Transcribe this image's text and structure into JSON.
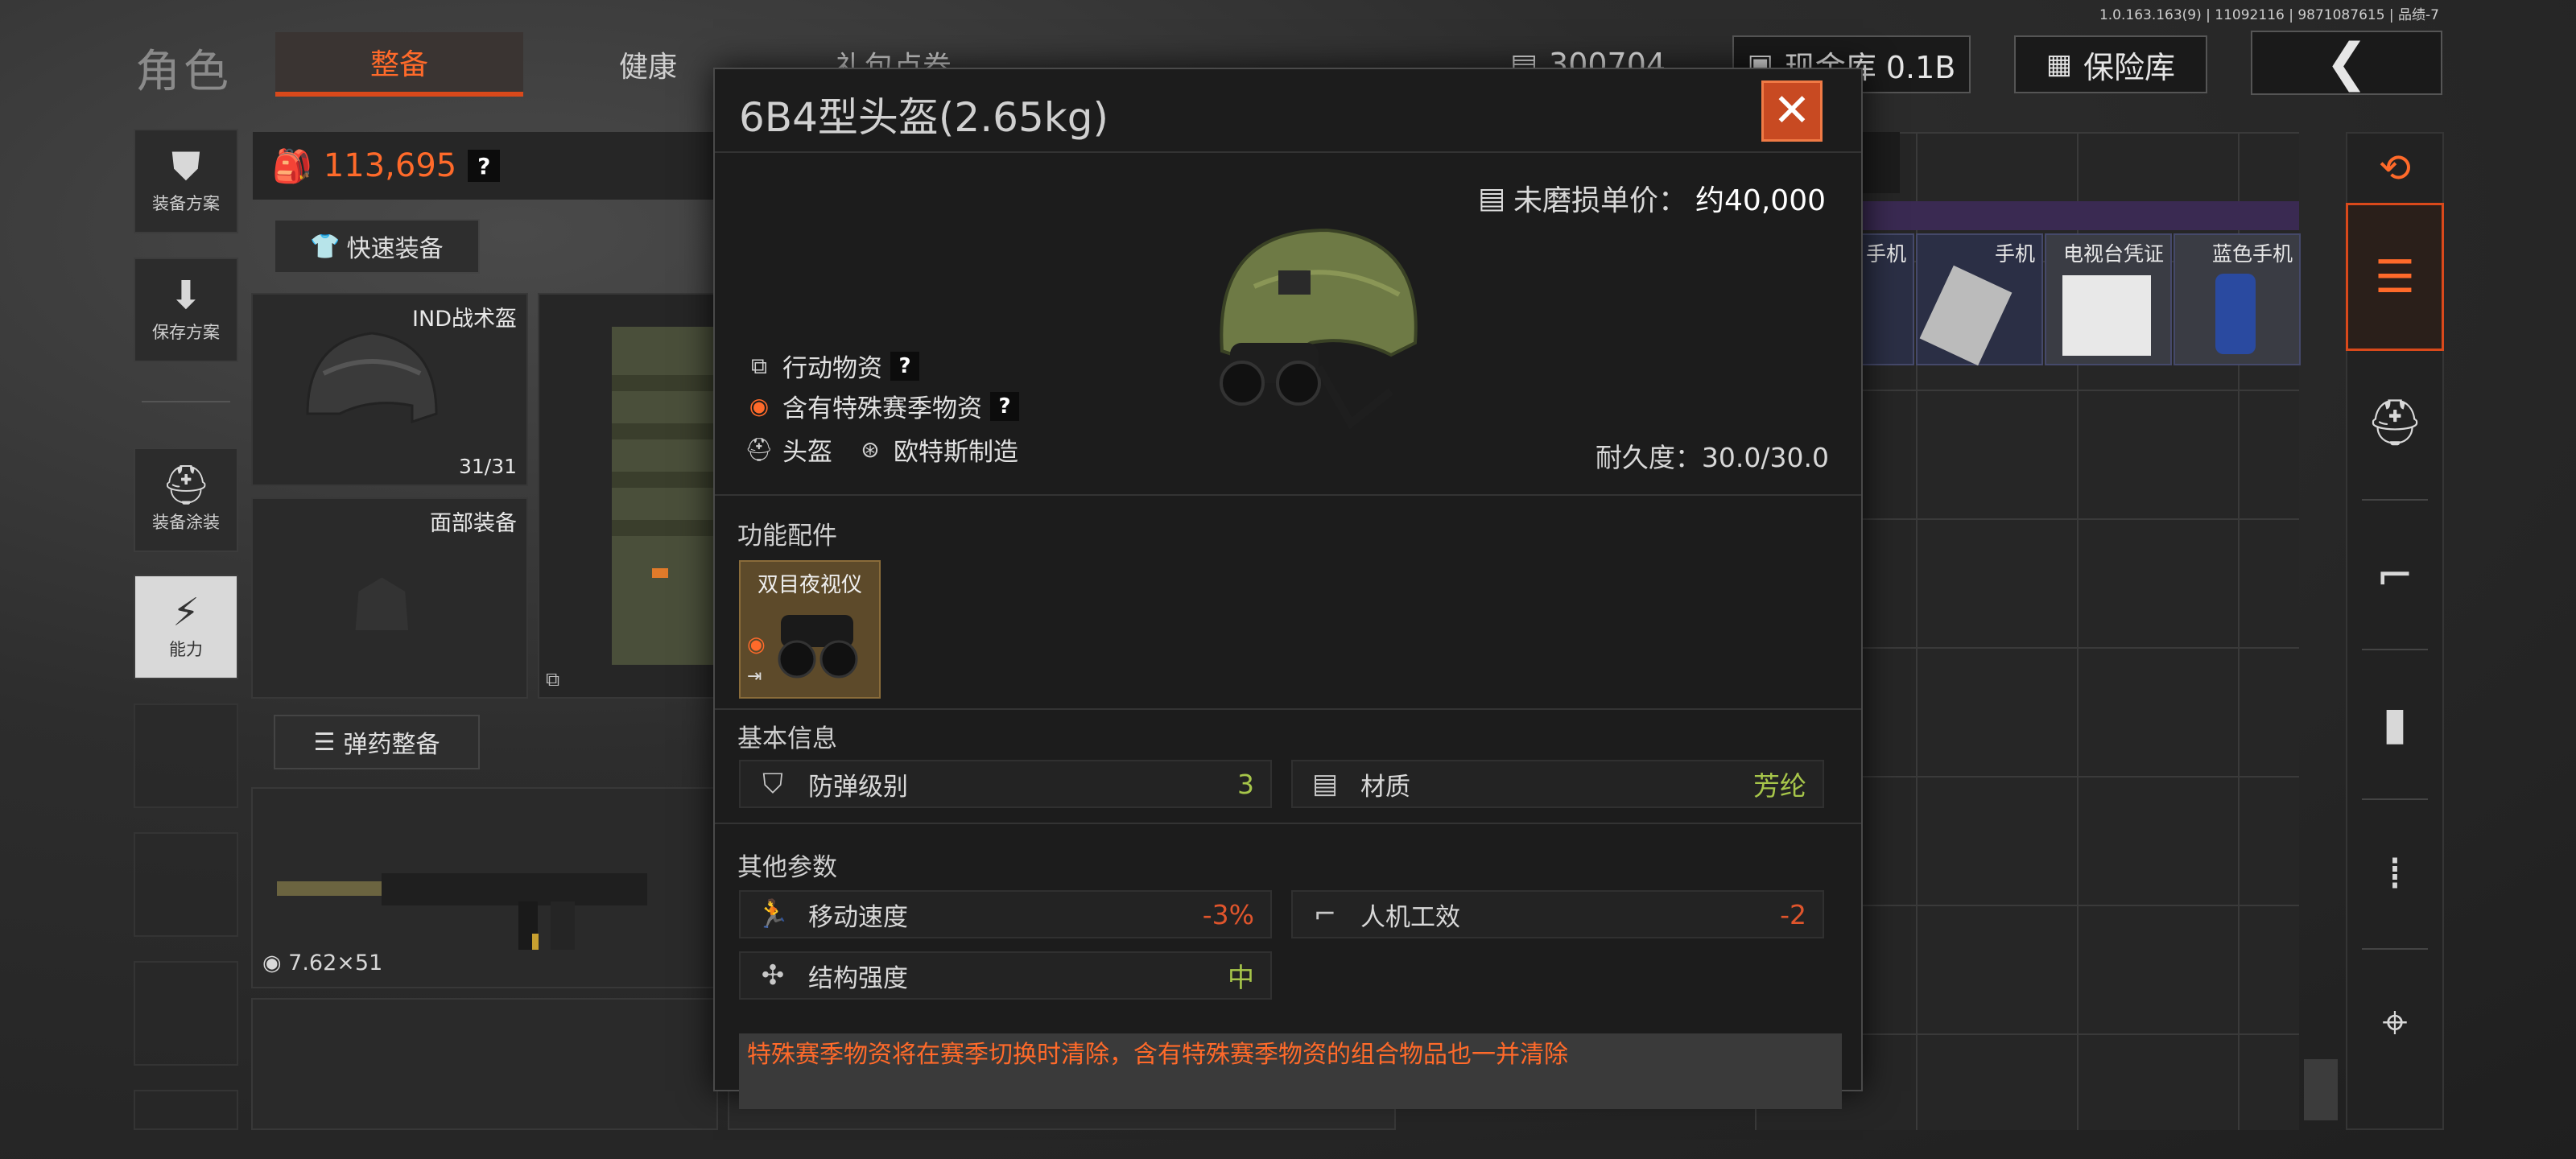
{
  "version": "1.0.163.163(9) | 11092116 | 9871087615 | 品绩-7",
  "header": {
    "title": "角色",
    "tabs": [
      {
        "label": "整备",
        "active": true
      },
      {
        "label": "健康",
        "active": false
      },
      {
        "label": "礼包点券",
        "active": false
      }
    ],
    "currency_value": "300704",
    "cash_label": "现金库 0.1B",
    "vault_label": "保险库",
    "back_glyph": "❮"
  },
  "sidebar": {
    "items": [
      {
        "label": "装备方案",
        "icon": "vest-icon"
      },
      {
        "label": "保存方案",
        "icon": "download-icon"
      },
      {
        "label": "装备涂装",
        "icon": "paint-helmet-icon"
      },
      {
        "label": "能力",
        "icon": "lightning-icon"
      }
    ]
  },
  "loadout": {
    "total_value": "113,695",
    "help": "?",
    "quick_equip_label": "快速装备",
    "helmet_slot_label": "IND战术盔",
    "helmet_slot_count": "31/31",
    "face_slot_label": "面部装备",
    "ammo_button_label": "弹药整备",
    "caliber": "7.62×51"
  },
  "inventory": {
    "items": [
      {
        "label": "手机"
      },
      {
        "label": "手机"
      },
      {
        "label": "电视台凭证"
      },
      {
        "label": "蓝色手机"
      }
    ]
  },
  "modal": {
    "title": "6B4型头盔(2.65kg)",
    "close_glyph": "✕",
    "price_label": "未磨损单价：",
    "price_value": "约40,000",
    "tags": [
      {
        "label": "行动物资",
        "icon": "box-icon",
        "has_help": true
      },
      {
        "label": "含有特殊赛季物资",
        "icon": "season-icon",
        "has_help": true
      }
    ],
    "type_label": "头盔",
    "maker_label": "欧特斯制造",
    "help": "?",
    "durability": "耐久度：30.0/30.0",
    "attachments_title": "功能配件",
    "attachment_name": "双目夜视仪",
    "basic_title": "基本信息",
    "basic_attrs": [
      {
        "name": "防弹级别",
        "value": "3",
        "icon": "shield-icon"
      },
      {
        "name": "材质",
        "value": "芳纶",
        "icon": "material-icon"
      }
    ],
    "other_title": "其他参数",
    "other_attrs": [
      {
        "name": "移动速度",
        "value": "-3%",
        "icon": "running-icon"
      },
      {
        "name": "人机工效",
        "value": "-2",
        "icon": "pistol-icon"
      },
      {
        "name": "结构强度",
        "value": "中",
        "icon": "structure-icon"
      }
    ],
    "warning": "特殊赛季物资将在赛季切换时清除，含有特殊赛季物资的组合物品也一并清除"
  },
  "colors": {
    "accent": "#ff6a2a",
    "positive": "#a7c64a",
    "negative": "#e0552c",
    "close": "#c84a22"
  }
}
